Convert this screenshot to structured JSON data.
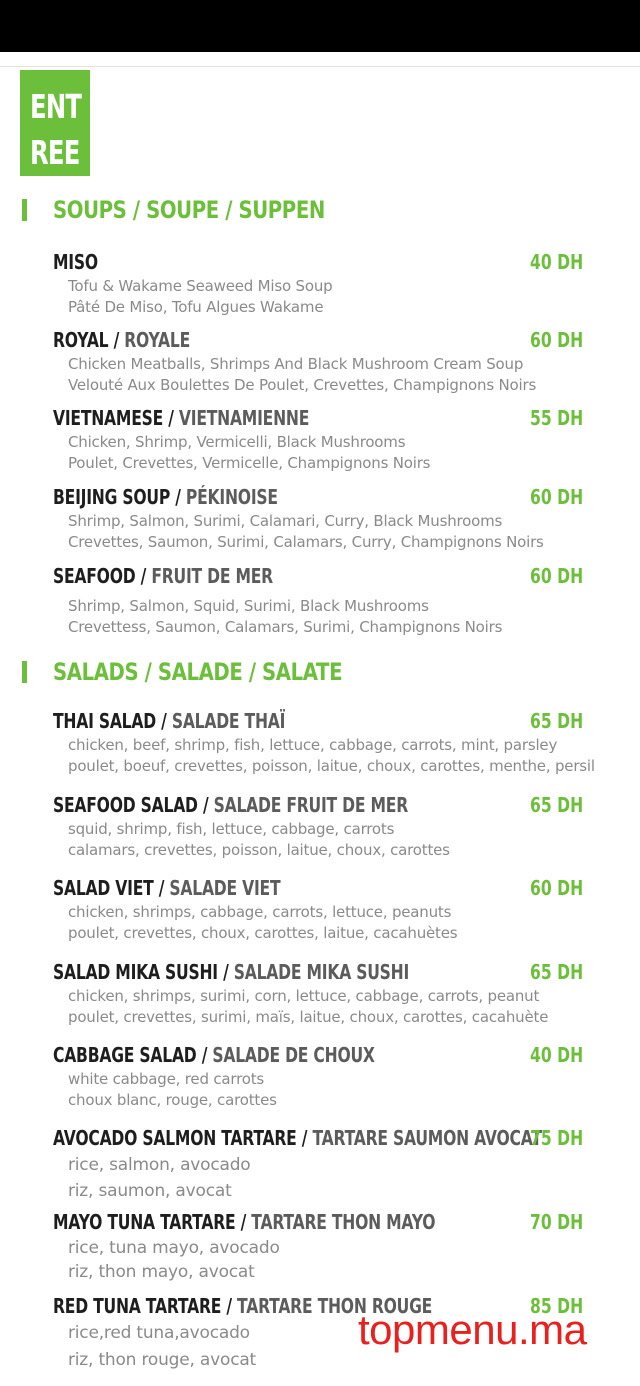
{
  "badge": {
    "line1": "ENT",
    "line2": "REE"
  },
  "colors": {
    "accent": "#6cbf3a",
    "watermark": "#e8201e"
  },
  "sections": {
    "soups": {
      "title": "SOUPS / SOUPE / SUPPEN",
      "items": [
        {
          "name": "MISO",
          "name_fr": "",
          "price": "40 DH",
          "desc1": "Tofu & Wakame Seaweed Miso Soup",
          "desc2": "Pâté De Miso, Tofu Algues Wakame"
        },
        {
          "name": "ROYAL",
          "name_fr": "ROYALE",
          "price": "60 DH",
          "desc1": "Chicken Meatballs, Shrimps And Black Mushroom Cream Soup",
          "desc2": "Velouté Aux Boulettes De Poulet, Crevettes, Champignons Noirs"
        },
        {
          "name": "VIETNAMESE",
          "name_fr": "VIETNAMIENNE",
          "price": "55 DH",
          "desc1": "Chicken, Shrimp, Vermicelli, Black Mushrooms",
          "desc2": "Poulet, Crevettes, Vermicelle, Champignons Noirs"
        },
        {
          "name": "BEIJING SOUP",
          "name_fr": "PÉKINOISE",
          "price": "60 DH",
          "desc1": "Shrimp, Salmon, Surimi, Calamari, Curry, Black Mushrooms",
          "desc2": "Crevettes, Saumon, Surimi, Calamars, Curry, Champignons Noirs"
        },
        {
          "name": "SEAFOOD",
          "name_fr": "FRUIT DE MER",
          "price": "60 DH",
          "desc1": "Shrimp, Salmon, Squid, Surimi, Black Mushrooms",
          "desc2": "Crevettess, Saumon, Calamars, Surimi, Champignons Noirs"
        }
      ]
    },
    "salads": {
      "title": "SALADS / SALADE / SALATE",
      "items": [
        {
          "name": "THAI SALAD",
          "name_fr": "SALADE THAÏ",
          "price": "65 DH",
          "desc1": "chicken, beef, shrimp, fish, lettuce, cabbage, carrots, mint, parsley",
          "desc2": "poulet, boeuf, crevettes, poisson, laitue, choux, carottes, menthe, persil"
        },
        {
          "name": "SEAFOOD SALAD",
          "name_fr": "SALADE FRUIT DE MER",
          "price": "65 DH",
          "desc1": "squid, shrimp, fish, lettuce, cabbage, carrots",
          "desc2": "calamars, crevettes, poisson, laitue, choux, carottes"
        },
        {
          "name": "SALAD VIET",
          "name_fr": "SALADE VIET",
          "price": "60 DH",
          "desc1": "chicken, shrimps, cabbage, carrots, lettuce, peanuts",
          "desc2": "poulet, crevettes, choux, carottes, laitue, cacahuètes"
        },
        {
          "name": "SALAD MIKA SUSHI",
          "name_fr": "SALADE MIKA SUSHI",
          "price": "65 DH",
          "desc1": "chicken, shrimps, surimi, corn, lettuce, cabbage, carrots, peanut",
          "desc2": "poulet, crevettes, surimi, maïs, laitue, choux, carottes, cacahuète"
        },
        {
          "name": "CABBAGE SALAD",
          "name_fr": "SALADE DE CHOUX",
          "price": "40 DH",
          "desc1": "white cabbage, red carrots",
          "desc2": "choux blanc, rouge, carottes"
        },
        {
          "name": "AVOCADO SALMON TARTARE",
          "name_fr": "TARTARE SAUMON AVOCAT",
          "price": "75 DH",
          "desc1": "rice, salmon, avocado",
          "desc2": "riz, saumon, avocat"
        },
        {
          "name": "MAYO TUNA TARTARE",
          "name_fr": "TARTARE THON MAYO",
          "price": "70 DH",
          "desc1": "rice, tuna mayo, avocado",
          "desc2": "riz, thon mayo, avocat"
        },
        {
          "name": "RED TUNA TARTARE",
          "name_fr": "TARTARE THON ROUGE",
          "price": "85 DH",
          "desc1": "rice,red tuna,avocado",
          "desc2": "riz, thon rouge, avocat"
        }
      ]
    }
  },
  "separator": " / ",
  "watermark": "topmenu.ma"
}
